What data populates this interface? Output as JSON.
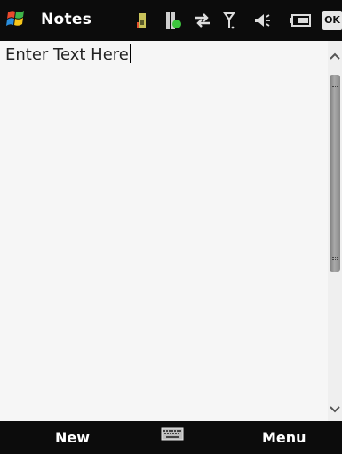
{
  "titlebar": {
    "app_title": "Notes",
    "start_icon": "windows-flag-icon",
    "tray_icons": [
      "sim-card-icon",
      "battery-charging-icon",
      "data-connectivity-icon",
      "signal-strength-icon",
      "volume-icon",
      "battery-icon"
    ],
    "ok_label": "OK"
  },
  "document": {
    "text": "Enter Text Here"
  },
  "softkeys": {
    "left_label": "New",
    "center_icon": "keyboard-icon",
    "right_label": "Menu"
  },
  "colors": {
    "bar_background": "#0c0c0c",
    "document_background": "#f6f6f6",
    "text": "#222222",
    "scroll_thumb": "#8a8a8a",
    "green_indicator": "#3ec63e"
  }
}
